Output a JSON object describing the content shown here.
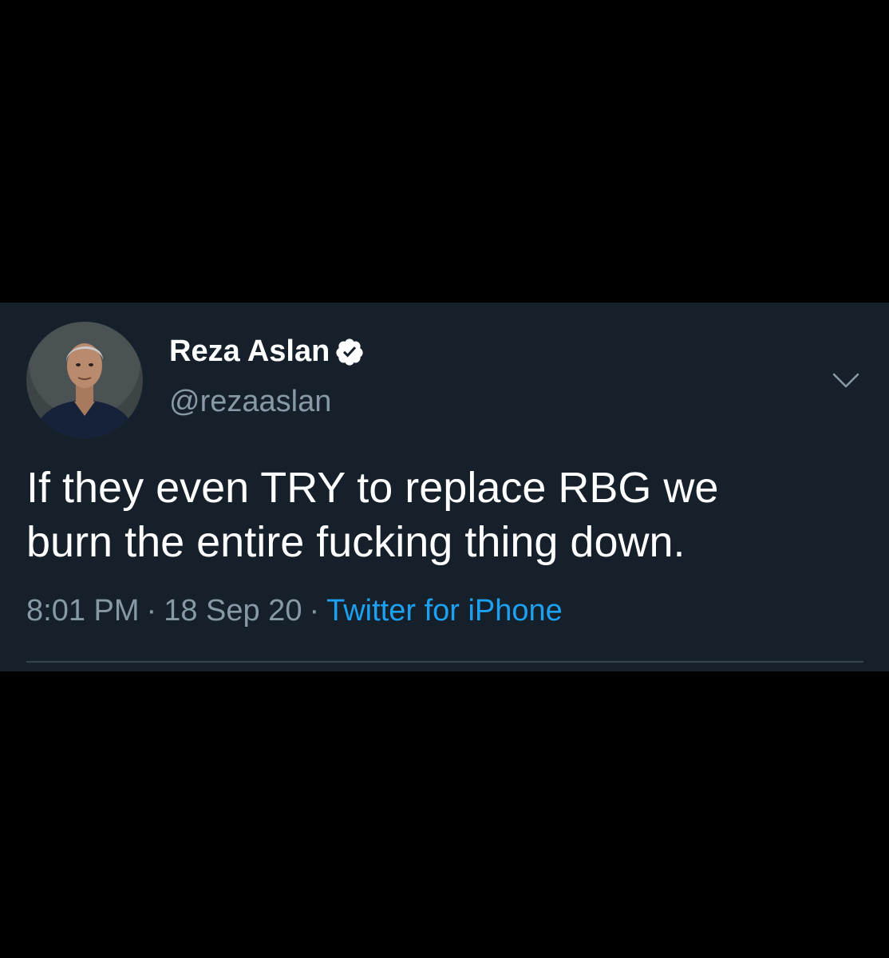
{
  "tweet": {
    "author": {
      "display_name": "Reza Aslan",
      "handle": "@rezaaslan",
      "verified": true,
      "verified_icon": "verified-badge-icon"
    },
    "text_lines": [
      "If they even TRY to replace RBG we",
      "burn the entire fucking thing down."
    ],
    "time": "8:01 PM",
    "separator": "·",
    "date": "18 Sep 20",
    "source": "Twitter for iPhone",
    "menu_icon": "chevron-down-icon"
  },
  "colors": {
    "background": "#000000",
    "card": "#15202b",
    "text": "#ffffff",
    "secondary": "#8899a6",
    "link": "#1da1f2",
    "divider": "#38444d"
  }
}
